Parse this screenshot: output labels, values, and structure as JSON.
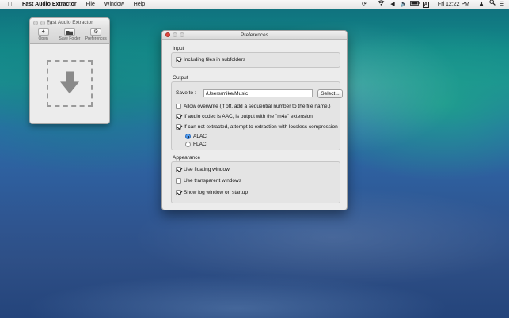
{
  "menubar": {
    "app_name": "Fast Audio Extractor",
    "items": [
      "File",
      "Window",
      "Help"
    ],
    "clock": "Fri 12:22 PM",
    "status_icons": [
      "sync-icon",
      "wifi-icon",
      "volume-icon",
      "battery-icon",
      "input-source-icon"
    ],
    "input_source": "A"
  },
  "app_window": {
    "title": "Fast Audio Extractor",
    "toolbar": [
      {
        "label": "Open",
        "icon": "plus-icon"
      },
      {
        "label": "Save Folder",
        "icon": "folder-icon"
      },
      {
        "label": "Preferences",
        "icon": "gear-icon"
      }
    ],
    "dropzone_icon": "download-arrow-icon"
  },
  "prefs": {
    "title": "Preferences",
    "input": {
      "label": "Input",
      "subfolders": {
        "label": "Including files in subfolders",
        "checked": true
      }
    },
    "output": {
      "label": "Output",
      "save_to_label": "Save to :",
      "save_to_value": "/Users/mike/Music",
      "select_label": "Select...",
      "allow_overwrite": {
        "label": "Allow overwrite (If off, add a sequential number to the file name.)",
        "checked": false
      },
      "aac_m4a": {
        "label": "If audio codec is AAC, is output with the \"m4a\" extension",
        "checked": true
      },
      "lossless": {
        "label": "If can not extracted, attempt to extraction with lossless compression",
        "checked": true
      },
      "codec_options": [
        {
          "label": "ALAC",
          "selected": true
        },
        {
          "label": "FLAC",
          "selected": false
        }
      ]
    },
    "appearance": {
      "label": "Appearance",
      "floating": {
        "label": "Use floating window",
        "checked": true
      },
      "transparent": {
        "label": "Use transparent windows",
        "checked": false
      },
      "log_window": {
        "label": "Show log window on startup",
        "checked": true
      }
    }
  }
}
